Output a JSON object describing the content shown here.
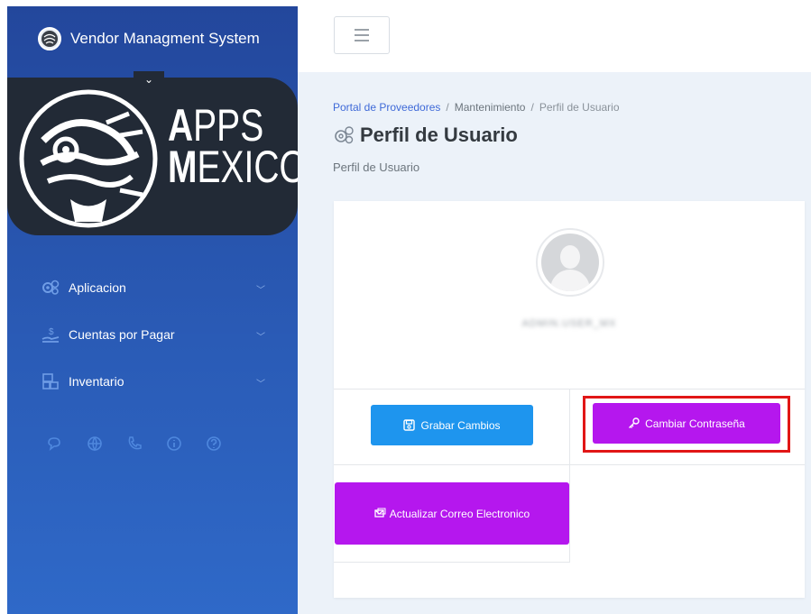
{
  "app": {
    "title": "Vendor Managment System"
  },
  "logo": {
    "line1_big": "A",
    "line1_rest": "PPS",
    "line2_big": "M",
    "line2_rest": "EXICO"
  },
  "sidebar": {
    "items": [
      {
        "label": "Aplicacion",
        "icon": "gears-icon"
      },
      {
        "label": "Cuentas por Pagar",
        "icon": "money-hand-icon"
      },
      {
        "label": "Inventario",
        "icon": "boxes-icon"
      }
    ],
    "utility_icons": [
      "chat-icon",
      "globe-icon",
      "phone-icon",
      "info-icon",
      "help-icon"
    ]
  },
  "breadcrumb": {
    "root": "Portal de Proveedores",
    "section": "Mantenimiento",
    "current": "Perfil de Usuario"
  },
  "page": {
    "title": "Perfil de Usuario",
    "subtitle": "Perfil de Usuario"
  },
  "profile": {
    "username": "ADMIN.USER_MX"
  },
  "buttons": {
    "save": "Grabar Cambios",
    "change_password": "Cambiar Contraseña",
    "update_email": "Actualizar Correo Electronico"
  },
  "colors": {
    "sidebar": "#2a5bb6",
    "primary": "#1e95ee",
    "purple": "#b517ee",
    "highlight": "#e11616"
  }
}
